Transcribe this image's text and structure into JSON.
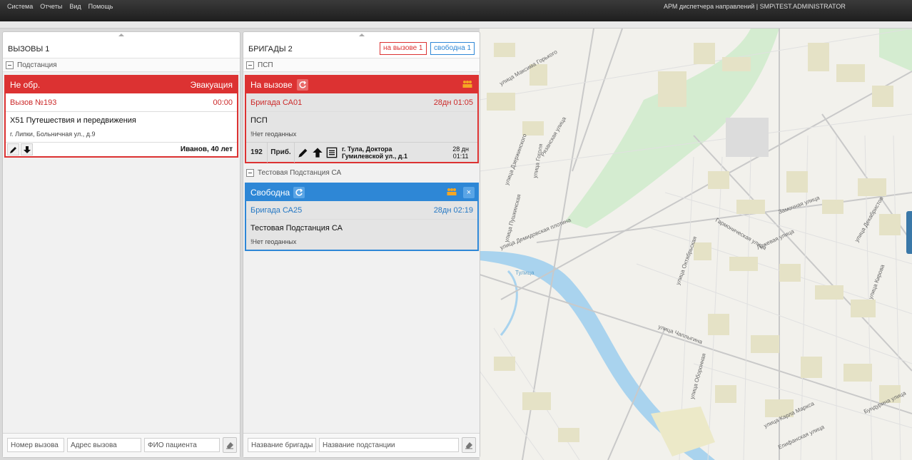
{
  "menu": [
    "Система",
    "Отчеты",
    "Вид",
    "Помощь"
  ],
  "app_title": "АРМ диспетчера направлений | SMP\\TEST.ADMINISTRATOR",
  "calls_panel": {
    "title": "ВЫЗОВЫ 1",
    "group_label": "Подстанция",
    "card": {
      "status": "Не обр.",
      "kind": "Эвакуация",
      "number": "Вызов №193",
      "time": "00:00",
      "reason": "X51 Путешествия и передвижения",
      "address": "г. Липки, Больничная ул., д.9",
      "patient": "Иванов, 40 лет"
    },
    "filters": {
      "number_placeholder": "Номер вызова",
      "address_placeholder": "Адрес вызова",
      "patient_placeholder": "ФИО пациента"
    }
  },
  "crews_panel": {
    "title": "БРИГАДЫ 2",
    "badge_on_call": "на вызове 1",
    "badge_free": "свободна 1",
    "group1_label": "ПСП",
    "group2_label": "Тестовая Подстанция СА",
    "crew1": {
      "status": "На вызове",
      "name": "Бригада СА01",
      "time": "28дн 01:05",
      "station": "ПСП",
      "geo": "!Нет геоданных",
      "call_number": "192",
      "arrival": "Приб.",
      "address_line1": "г. Тула, Доктора",
      "address_line2": "Гумилевской ул., д.1",
      "elapsed_line1": "28 дн",
      "elapsed_line2": "01:11"
    },
    "crew2": {
      "status": "Свободна",
      "name": "Бригада СА25",
      "time": "28дн 02:19",
      "station": "Тестовая Подстанция СА",
      "geo": "!Нет геоданных",
      "close_label": "×"
    },
    "filters": {
      "crew_placeholder": "Название бригады",
      "station_placeholder": "Название подстанции"
    }
  },
  "map": {
    "street_labels": [
      "улица Максима Горького",
      "улица Гоголя",
      "Рязанская улица",
      "улица Дзержинского",
      "улица Демидовская плотина",
      "улица Октябрьская",
      "Гармоническая улица",
      "Ложевая улица",
      "Замочная улица",
      "улица Декабристов",
      "улица Пушкинская",
      "улица Кирова",
      "улица Чаплыгина",
      "Бундурина улица",
      "улица Карла Маркса",
      "Епифанская улица",
      "улица Оборонная",
      "Тулица"
    ]
  },
  "colors": {
    "red": "#dc3232",
    "blue": "#2e87d6",
    "river": "#a9d3ee",
    "park": "#d4ecd0"
  }
}
